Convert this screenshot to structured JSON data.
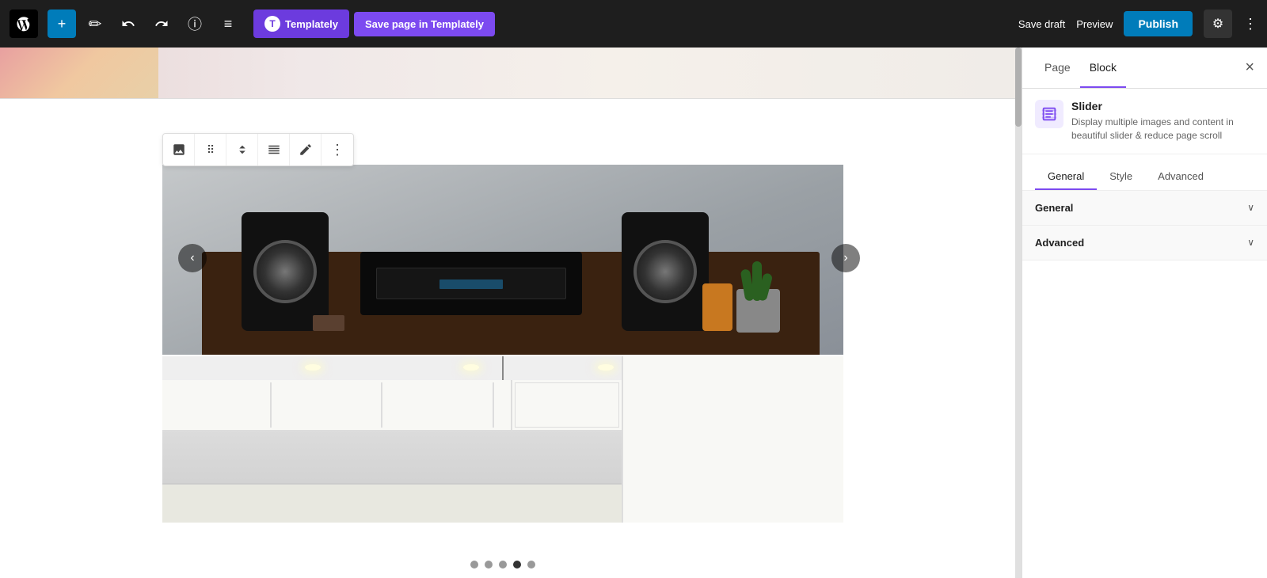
{
  "toolbar": {
    "add_label": "+",
    "undo_label": "↺",
    "redo_label": "↻",
    "info_label": "ⓘ",
    "list_label": "≡",
    "templately_label": "Templately",
    "save_templately_label": "Save page in Templately",
    "save_draft_label": "Save draft",
    "preview_label": "Preview",
    "publish_label": "Publish",
    "settings_icon": "⚙",
    "more_icon": "⋮"
  },
  "block_toolbar": {
    "image_icon": "🖼",
    "drag_icon": "⠿",
    "move_icon": "↕",
    "align_icon": "▬",
    "edit_icon": "✏",
    "more_icon": "⋮"
  },
  "sidebar": {
    "tabs": [
      {
        "id": "page",
        "label": "Page"
      },
      {
        "id": "block",
        "label": "Block",
        "active": true
      }
    ],
    "close_label": "×",
    "block_name": "Slider",
    "block_desc": "Display multiple images and content in beautiful slider & reduce page scroll",
    "subtabs": [
      {
        "id": "general",
        "label": "General",
        "active": true
      },
      {
        "id": "style",
        "label": "Style"
      },
      {
        "id": "advanced",
        "label": "Advanced"
      }
    ],
    "sections": [
      {
        "id": "general",
        "label": "General",
        "expanded": false
      },
      {
        "id": "advanced",
        "label": "Advanced",
        "expanded": false
      }
    ]
  },
  "slider": {
    "dots": [
      {
        "id": 1,
        "active": false
      },
      {
        "id": 2,
        "active": false
      },
      {
        "id": 3,
        "active": false
      },
      {
        "id": 4,
        "active": true
      },
      {
        "id": 5,
        "active": false
      }
    ],
    "prev_label": "‹",
    "next_label": "›"
  }
}
